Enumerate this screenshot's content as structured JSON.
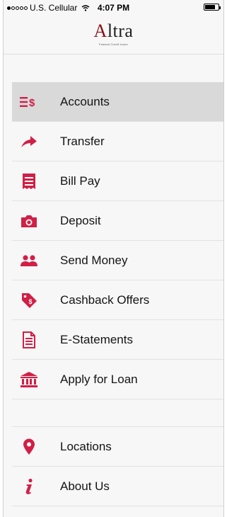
{
  "status_bar": {
    "carrier": "U.S. Cellular",
    "time": "4:07 PM",
    "signal_bars": 1
  },
  "logo": {
    "first_letter": "A",
    "rest": "ltra",
    "tagline": "Federal Credit Union"
  },
  "colors": {
    "accent": "#d11f46",
    "active_row": "#d9d9d9"
  },
  "menu": {
    "items": [
      {
        "label": "Accounts",
        "icon": "accounts-icon",
        "active": true
      },
      {
        "label": "Transfer",
        "icon": "transfer-arrow-icon"
      },
      {
        "label": "Bill Pay",
        "icon": "bill-icon"
      },
      {
        "label": "Deposit",
        "icon": "camera-icon"
      },
      {
        "label": "Send Money",
        "icon": "people-icon"
      },
      {
        "label": "Cashback Offers",
        "icon": "tag-icon"
      },
      {
        "label": "E-Statements",
        "icon": "document-icon"
      },
      {
        "label": "Apply for Loan",
        "icon": "bank-icon"
      }
    ],
    "secondary": [
      {
        "label": "Locations",
        "icon": "map-pin-icon"
      },
      {
        "label": "About Us",
        "icon": "info-icon"
      }
    ]
  }
}
